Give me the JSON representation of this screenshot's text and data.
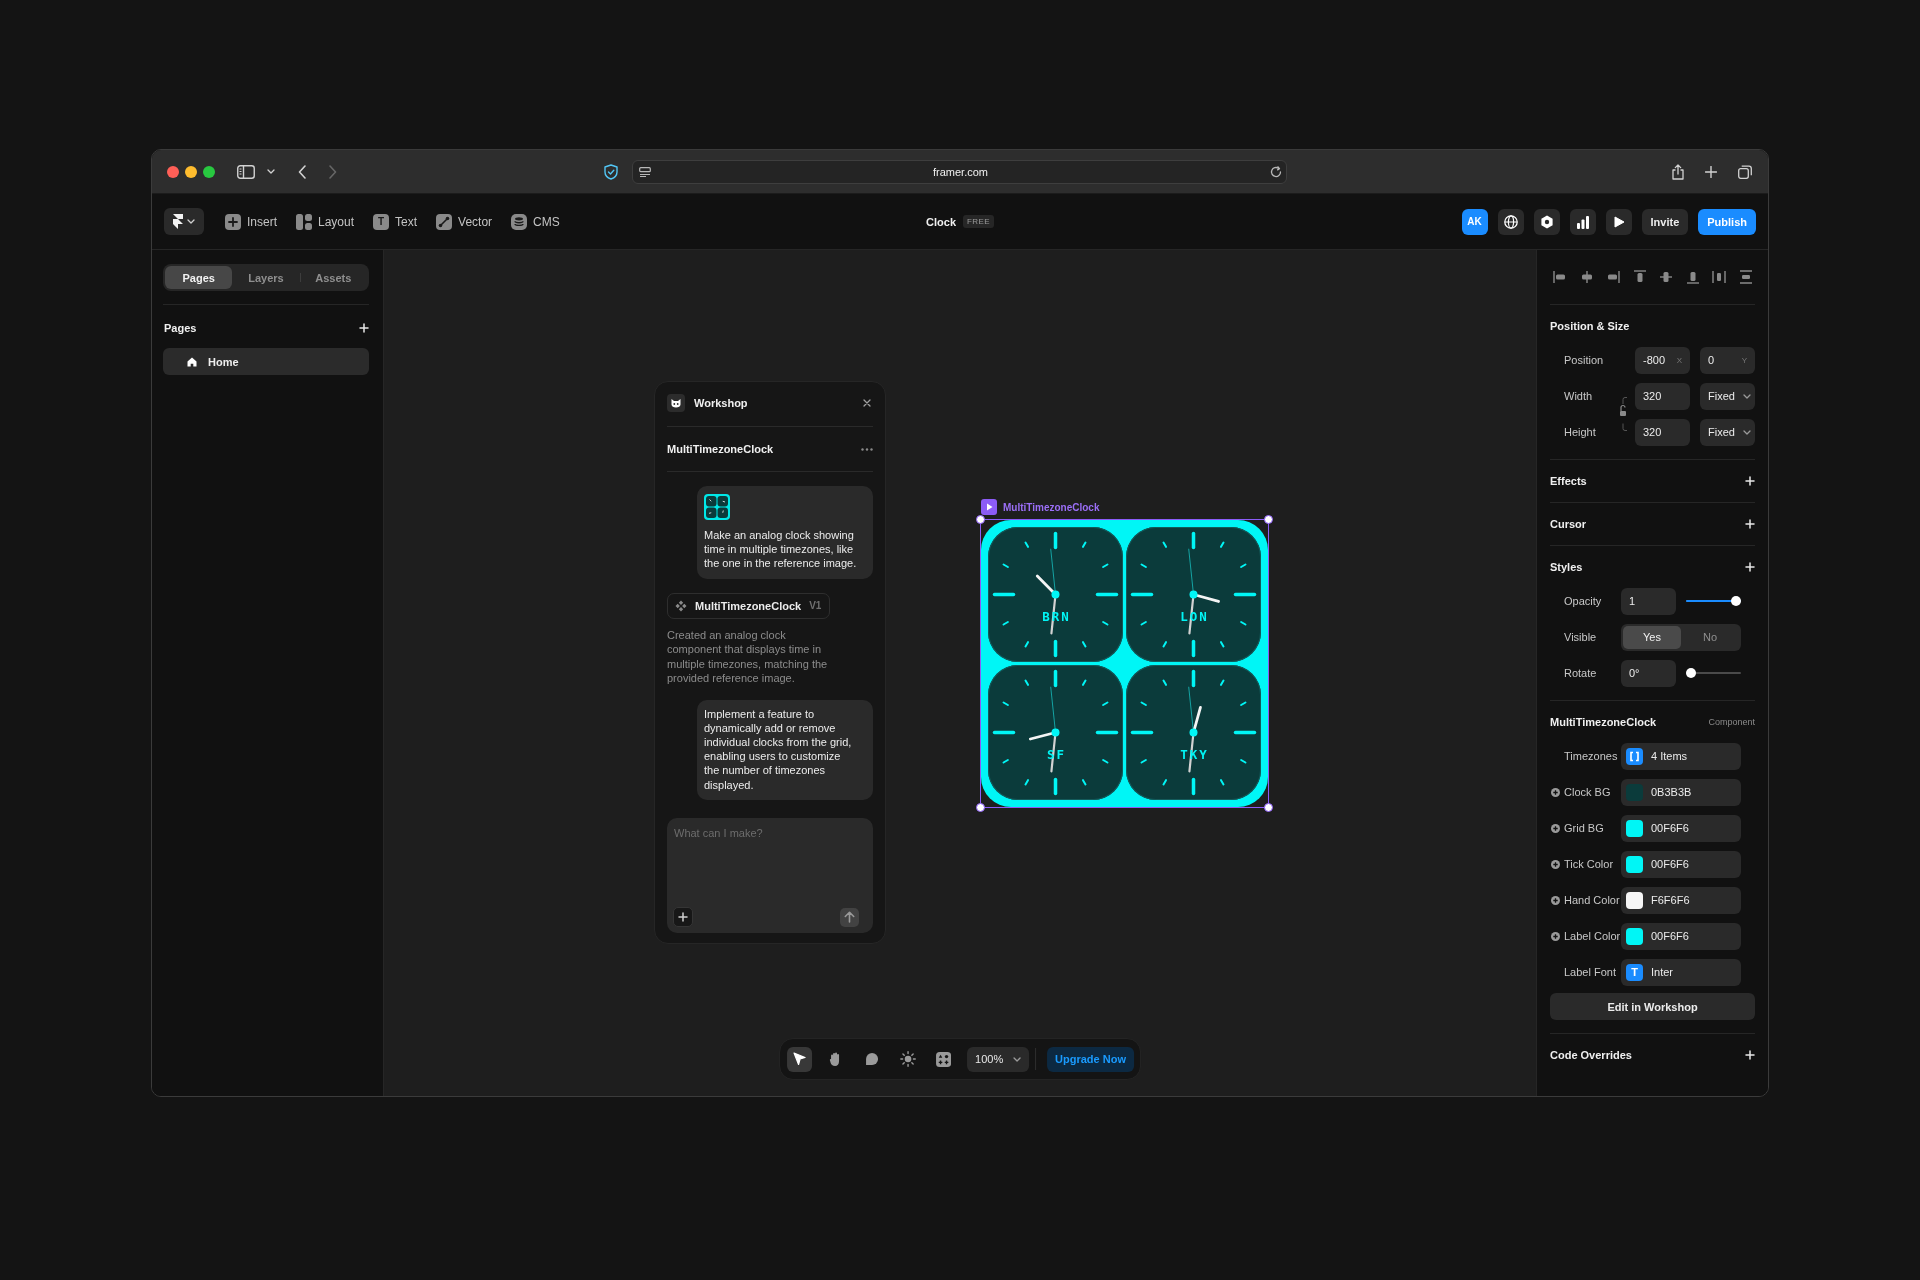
{
  "browser": {
    "url": "framer.com"
  },
  "toolbar": {
    "items": [
      {
        "kind": "insert",
        "label": "Insert"
      },
      {
        "kind": "layout",
        "label": "Layout"
      },
      {
        "kind": "text",
        "label": "Text",
        "icon": "T"
      },
      {
        "kind": "vector",
        "label": "Vector"
      },
      {
        "kind": "cms",
        "label": "CMS"
      }
    ],
    "project": "Clock",
    "plan": "FREE",
    "avatar": "AK",
    "invite": "Invite",
    "publish": "Publish"
  },
  "left_panel": {
    "tabs": [
      {
        "label": "Pages",
        "selected": true
      },
      {
        "label": "Layers",
        "selected": false
      },
      {
        "label": "Assets",
        "selected": false
      }
    ],
    "heading": "Pages",
    "pages": [
      {
        "label": "Home",
        "selected": true
      }
    ]
  },
  "workshop": {
    "title": "Workshop",
    "component": "MultiTimezoneClock",
    "messages": [
      {
        "kind": "prompt",
        "attachment": true,
        "text": "Make an analog clock showing time in multiple timezones, like the one in the reference image."
      },
      {
        "kind": "version",
        "name": "MultiTimezoneClock",
        "version": "V1"
      },
      {
        "kind": "reply",
        "text": "Created an analog clock component that displays time in multiple timezones, matching the provided reference image."
      },
      {
        "kind": "prompt",
        "attachment": false,
        "text": "Implement a feature to dynamically add or remove individual clocks from the grid, enabling users to customize the number of timezones displayed."
      }
    ],
    "input": {
      "placeholder": "What can I make?"
    }
  },
  "canvas": {
    "component_label": "MultiTimezoneClock",
    "clocks": [
      {
        "label": "BRN"
      },
      {
        "label": "LON"
      },
      {
        "label": "SF"
      },
      {
        "label": "TKY"
      }
    ]
  },
  "bottom_toolbar": {
    "tools": [
      {
        "kind": "select",
        "selected": true
      },
      {
        "kind": "hand",
        "selected": false
      },
      {
        "kind": "comment",
        "selected": false
      },
      {
        "kind": "theme",
        "selected": false
      },
      {
        "kind": "components",
        "selected": false
      }
    ],
    "zoom": "100%",
    "upgrade": "Upgrade Now"
  },
  "inspector": {
    "position_size": {
      "title": "Position & Size",
      "aspect_locked": false,
      "rows": [
        {
          "label": "Position",
          "fields": [
            {
              "kind": "number",
              "value": "-800",
              "suffix": "X"
            },
            {
              "kind": "number",
              "value": "0",
              "suffix": "Y"
            }
          ]
        },
        {
          "label": "Width",
          "fields": [
            {
              "kind": "number",
              "value": "320"
            },
            {
              "kind": "select",
              "value": "Fixed"
            }
          ]
        },
        {
          "label": "Height",
          "fields": [
            {
              "kind": "number",
              "value": "320"
            },
            {
              "kind": "select",
              "value": "Fixed"
            }
          ]
        }
      ]
    },
    "sections": [
      {
        "title": "Effects"
      },
      {
        "title": "Cursor"
      }
    ],
    "styles": {
      "title": "Styles",
      "opacity": {
        "label": "Opacity",
        "value": "1",
        "level": 1
      },
      "visible": {
        "label": "Visible",
        "options": [
          {
            "label": "Yes",
            "selected": true
          },
          {
            "label": "No",
            "selected": false
          }
        ]
      },
      "rotate": {
        "label": "Rotate",
        "value": "0°",
        "level": 0
      }
    },
    "component": {
      "title": "MultiTimezoneClock",
      "tag": "Component",
      "props": [
        {
          "kind": "array",
          "label": "Timezones",
          "value": "4 Items"
        },
        {
          "kind": "color",
          "label": "Clock BG",
          "value": "0B3B3B",
          "color": "#0b3b3b"
        },
        {
          "kind": "color",
          "label": "Grid BG",
          "value": "00F6F6",
          "color": "#00f6f6"
        },
        {
          "kind": "color",
          "label": "Tick Color",
          "value": "00F6F6",
          "color": "#00f6f6"
        },
        {
          "kind": "color",
          "label": "Hand Color",
          "value": "F6F6F6",
          "color": "#f6f6f6"
        },
        {
          "kind": "color",
          "label": "Label Color",
          "value": "00F6F6",
          "color": "#00f6f6"
        },
        {
          "kind": "font",
          "label": "Label Font",
          "value": "Inter",
          "icon": "T"
        }
      ],
      "action": "Edit in Workshop"
    },
    "code_overrides": {
      "title": "Code Overrides"
    }
  }
}
